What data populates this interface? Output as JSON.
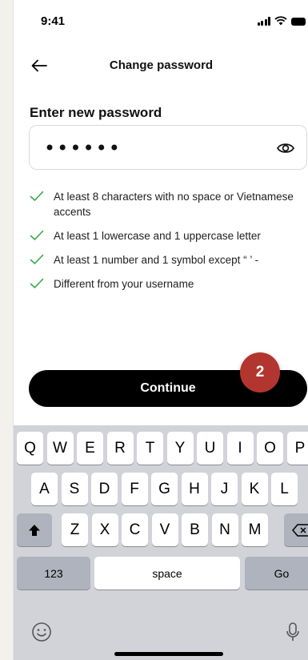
{
  "status_bar": {
    "time": "9:41"
  },
  "header": {
    "title": "Change password"
  },
  "form": {
    "label": "Enter new password",
    "password_masked": "••••••"
  },
  "rules": [
    {
      "text": "At least 8 characters with no space or Vietnamese accents",
      "met": true
    },
    {
      "text": "At least 1 lowercase and 1 uppercase letter",
      "met": true
    },
    {
      "text": "At least 1 number and 1 symbol except “ ’ -",
      "met": true
    },
    {
      "text": "Different from your username",
      "met": true
    }
  ],
  "continue_label": "Continue",
  "step_badge": "2",
  "colors": {
    "check": "#39a845",
    "badge": "#b3352f",
    "button": "#000000"
  },
  "keyboard": {
    "row1": [
      "Q",
      "W",
      "E",
      "R",
      "T",
      "Y",
      "U",
      "I",
      "O",
      "P"
    ],
    "row2": [
      "A",
      "S",
      "D",
      "F",
      "G",
      "H",
      "J",
      "K",
      "L"
    ],
    "row3": [
      "Z",
      "X",
      "C",
      "V",
      "B",
      "N",
      "M"
    ],
    "numbers_label": "123",
    "space_label": "space",
    "go_label": "Go",
    "shift_icon": "shift-icon",
    "backspace_icon": "backspace-icon",
    "emoji_icon": "emoji-icon",
    "mic_icon": "microphone-icon"
  }
}
